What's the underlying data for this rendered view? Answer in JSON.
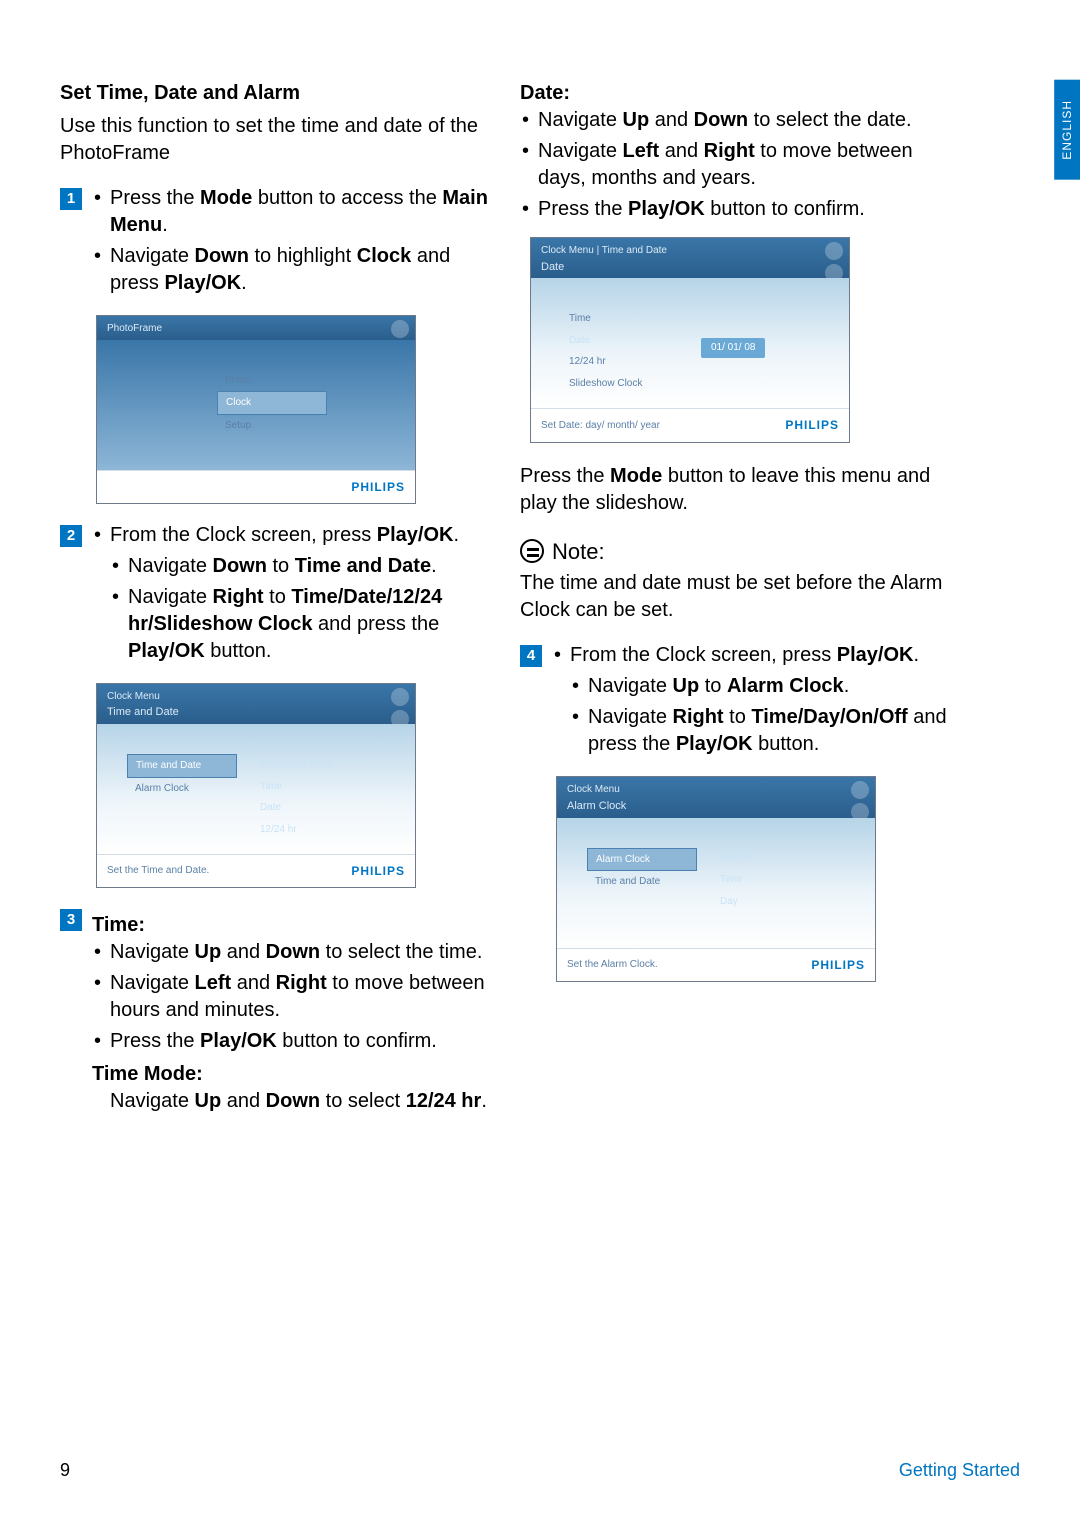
{
  "lang_tab": "ENGLISH",
  "left": {
    "title": "Set Time, Date and Alarm",
    "intro": "Use this function to set the time and date of the PhotoFrame",
    "step1": {
      "num": "1",
      "b1_pre": "Press the ",
      "b1_bold": "Mode",
      "b1_post": " button to access the ",
      "b1_bold2": "Main Menu",
      "b2_pre": "Navigate ",
      "b2_bold": "Down",
      "b2_mid": " to highlight ",
      "b2_bold2": "Clock",
      "b2_mid2": " and press ",
      "b2_bold3": "Play/OK"
    },
    "dev1": {
      "crumb": "PhotoFrame",
      "items": [
        "Photo",
        "Clock",
        "Setup"
      ],
      "brand": "PHILIPS"
    },
    "step2": {
      "num": "2",
      "b1_pre": "From the Clock screen, press ",
      "b1_bold": "Play/OK",
      "s1_pre": "Navigate ",
      "s1_bold": "Down",
      "s1_mid": " to ",
      "s1_bold2": "Time and Date",
      "s2_pre": "Navigate ",
      "s2_bold": "Right",
      "s2_mid": " to ",
      "s2_bold2": "Time/Date/12/24 hr/Slideshow Clock",
      "s2_mid2": " and press the ",
      "s2_bold3": "Play/OK",
      "s2_post": " button."
    },
    "dev2": {
      "crumb": "Clock Menu",
      "title": "Time and Date",
      "left_items": [
        "Time and Date",
        "Alarm Clock"
      ],
      "right_items": [
        "Slideshow Clock",
        "Time",
        "Date",
        "12/24 hr"
      ],
      "hint": "Set the Time and Date.",
      "brand": "PHILIPS"
    },
    "step3": {
      "num": "3",
      "heading": "Time:",
      "s1_pre": "Navigate ",
      "s1_b1": "Up",
      "s1_mid": " and ",
      "s1_b2": "Down",
      "s1_post": " to select the time.",
      "s2_pre": "Navigate ",
      "s2_b1": "Left",
      "s2_mid": " and ",
      "s2_b2": "Right",
      "s2_post": " to move between hours and minutes.",
      "s3_pre": "Press the ",
      "s3_b1": "Play/OK",
      "s3_post": " button to confirm.",
      "heading2": "Time Mode:",
      "tm_pre": "Navigate ",
      "tm_b1": "Up",
      "tm_mid": " and ",
      "tm_b2": "Down",
      "tm_mid2": " to select ",
      "tm_b3": "12/24 hr"
    }
  },
  "right": {
    "heading": "Date:",
    "s1_pre": "Navigate ",
    "s1_b1": "Up",
    "s1_mid": " and ",
    "s1_b2": "Down",
    "s1_post": " to select the date.",
    "s2_pre": "Navigate ",
    "s2_b1": "Left",
    "s2_mid": " and ",
    "s2_b2": "Right",
    "s2_post": " to move between days, months and years.",
    "s3_pre": "Press the ",
    "s3_b1": "Play/OK",
    "s3_post": " button to confirm.",
    "dev3": {
      "crumb": "Clock Menu | Time and Date",
      "title": "Date",
      "left_items": [
        "Time",
        "Date",
        "12/24 hr",
        "Slideshow Clock"
      ],
      "value": "01/ 01/ 08",
      "hint": "Set Date: day/ month/ year",
      "brand": "PHILIPS"
    },
    "after_dev_pre": "Press the ",
    "after_dev_b": "Mode",
    "after_dev_post": " button to leave this menu and play the slideshow.",
    "note_label": "Note:",
    "note_text": "The time and date must be set before the Alarm Clock can be set.",
    "step4": {
      "num": "4",
      "b1_pre": "From the Clock screen, press ",
      "b1_bold": "Play/OK",
      "s1_pre": "Navigate ",
      "s1_b1": "Up",
      "s1_mid": " to ",
      "s1_b2": "Alarm Clock",
      "s2_pre": "Navigate ",
      "s2_b1": "Right",
      "s2_mid": " to ",
      "s2_b2": "Time/Day/On/Off",
      "s2_mid2": " and press the ",
      "s2_b3": "Play/OK",
      "s2_post": " button."
    },
    "dev4": {
      "crumb": "Clock Menu",
      "title": "Alarm Clock",
      "left_items": [
        "Alarm Clock",
        "Time and Date"
      ],
      "right_items": [
        "On/ Off",
        "Time",
        "Day"
      ],
      "hint": "Set the Alarm Clock.",
      "brand": "PHILIPS"
    }
  },
  "footer": {
    "page": "9",
    "section": "Getting Started"
  }
}
